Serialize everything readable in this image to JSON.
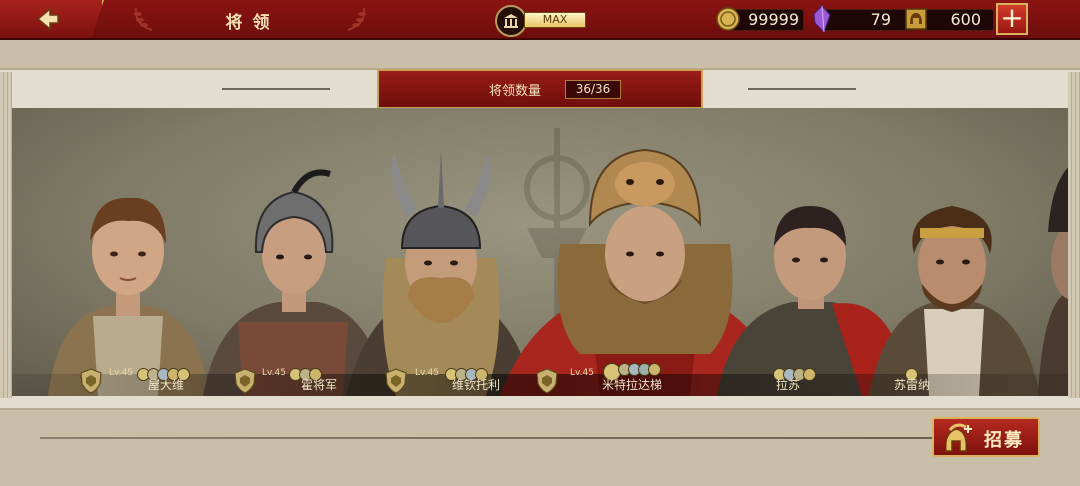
{
  "header": {
    "title": "将领",
    "museum_level": "MAX",
    "gold": "99999",
    "gems": "79",
    "tokens": "600",
    "plus_label": "+"
  },
  "panel": {
    "count_label": "将领数量",
    "count_value": "36/36"
  },
  "heroes": [
    {
      "name": "屋大维",
      "level": "Lv.45"
    },
    {
      "name": "霍将军",
      "level": "Lv.45"
    },
    {
      "name": "维钦托利",
      "level": "Lv.45"
    },
    {
      "name": "米特拉达梯",
      "level": "Lv.45"
    },
    {
      "name": "拉苏",
      "level": ""
    },
    {
      "name": "苏雷纳",
      "level": ""
    }
  ],
  "footer": {
    "recruit_label": "招募"
  },
  "icons": {
    "back": "back-arrow-icon",
    "museum": "museum-icon",
    "gold": "gold-coin-icon",
    "gem": "purple-crystal-icon",
    "token": "helmet-token-icon",
    "recruit": "spartan-helmet-icon"
  },
  "colors": {
    "topbar": "#7a110f",
    "accent_gold": "#d9b15f",
    "gallery_bg": "#7f7a66"
  }
}
